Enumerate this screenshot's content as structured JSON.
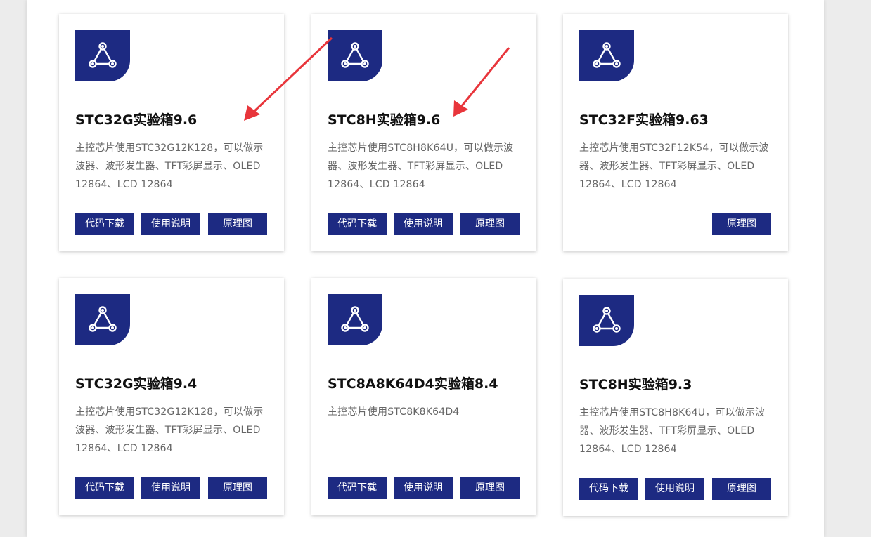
{
  "cards": [
    {
      "title": "STC32G实验箱9.6",
      "desc": "主控芯片使用STC32G12K128，可以做示波器、波形发生器、TFT彩屏显示、OLED 12864、LCD 12864",
      "buttons": [
        "代码下载",
        "使用说明",
        "原理图"
      ]
    },
    {
      "title": "STC8H实验箱9.6",
      "desc": "主控芯片使用STC8H8K64U，可以做示波器、波形发生器、TFT彩屏显示、OLED 12864、LCD 12864",
      "buttons": [
        "代码下载",
        "使用说明",
        "原理图"
      ]
    },
    {
      "title": "STC32F实验箱9.63",
      "desc": "主控芯片使用STC32F12K54，可以做示波器、波形发生器、TFT彩屏显示、OLED 12864、LCD 12864",
      "buttons": [
        "原理图"
      ]
    },
    {
      "title": "STC32G实验箱9.4",
      "desc": "主控芯片使用STC32G12K128，可以做示波器、波形发生器、TFT彩屏显示、OLED 12864、LCD 12864",
      "buttons": [
        "代码下载",
        "使用说明",
        "原理图"
      ]
    },
    {
      "title": "STC8A8K64D4实验箱8.4",
      "desc": "主控芯片使用STC8K8K64D4",
      "buttons": [
        "代码下载",
        "使用说明",
        "原理图"
      ]
    },
    {
      "title": "STC8H实验箱9.3",
      "desc": "主控芯片使用STC8H8K64U，可以做示波器、波形发生器、TFT彩屏显示、OLED 12864、LCD 12864",
      "buttons": [
        "代码下载",
        "使用说明",
        "原理图"
      ]
    }
  ],
  "colors": {
    "brand": "#1d2a82",
    "annotation_arrow": "#e8353b"
  },
  "icon": "share-network-icon"
}
